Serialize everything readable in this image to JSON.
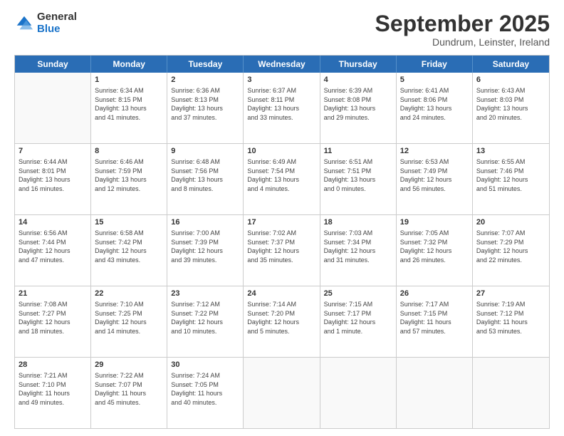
{
  "logo": {
    "general": "General",
    "blue": "Blue"
  },
  "title": "September 2025",
  "location": "Dundrum, Leinster, Ireland",
  "days": [
    "Sunday",
    "Monday",
    "Tuesday",
    "Wednesday",
    "Thursday",
    "Friday",
    "Saturday"
  ],
  "weeks": [
    [
      {
        "day": "",
        "info": ""
      },
      {
        "day": "1",
        "info": "Sunrise: 6:34 AM\nSunset: 8:15 PM\nDaylight: 13 hours\nand 41 minutes."
      },
      {
        "day": "2",
        "info": "Sunrise: 6:36 AM\nSunset: 8:13 PM\nDaylight: 13 hours\nand 37 minutes."
      },
      {
        "day": "3",
        "info": "Sunrise: 6:37 AM\nSunset: 8:11 PM\nDaylight: 13 hours\nand 33 minutes."
      },
      {
        "day": "4",
        "info": "Sunrise: 6:39 AM\nSunset: 8:08 PM\nDaylight: 13 hours\nand 29 minutes."
      },
      {
        "day": "5",
        "info": "Sunrise: 6:41 AM\nSunset: 8:06 PM\nDaylight: 13 hours\nand 24 minutes."
      },
      {
        "day": "6",
        "info": "Sunrise: 6:43 AM\nSunset: 8:03 PM\nDaylight: 13 hours\nand 20 minutes."
      }
    ],
    [
      {
        "day": "7",
        "info": "Sunrise: 6:44 AM\nSunset: 8:01 PM\nDaylight: 13 hours\nand 16 minutes."
      },
      {
        "day": "8",
        "info": "Sunrise: 6:46 AM\nSunset: 7:59 PM\nDaylight: 13 hours\nand 12 minutes."
      },
      {
        "day": "9",
        "info": "Sunrise: 6:48 AM\nSunset: 7:56 PM\nDaylight: 13 hours\nand 8 minutes."
      },
      {
        "day": "10",
        "info": "Sunrise: 6:49 AM\nSunset: 7:54 PM\nDaylight: 13 hours\nand 4 minutes."
      },
      {
        "day": "11",
        "info": "Sunrise: 6:51 AM\nSunset: 7:51 PM\nDaylight: 13 hours\nand 0 minutes."
      },
      {
        "day": "12",
        "info": "Sunrise: 6:53 AM\nSunset: 7:49 PM\nDaylight: 12 hours\nand 56 minutes."
      },
      {
        "day": "13",
        "info": "Sunrise: 6:55 AM\nSunset: 7:46 PM\nDaylight: 12 hours\nand 51 minutes."
      }
    ],
    [
      {
        "day": "14",
        "info": "Sunrise: 6:56 AM\nSunset: 7:44 PM\nDaylight: 12 hours\nand 47 minutes."
      },
      {
        "day": "15",
        "info": "Sunrise: 6:58 AM\nSunset: 7:42 PM\nDaylight: 12 hours\nand 43 minutes."
      },
      {
        "day": "16",
        "info": "Sunrise: 7:00 AM\nSunset: 7:39 PM\nDaylight: 12 hours\nand 39 minutes."
      },
      {
        "day": "17",
        "info": "Sunrise: 7:02 AM\nSunset: 7:37 PM\nDaylight: 12 hours\nand 35 minutes."
      },
      {
        "day": "18",
        "info": "Sunrise: 7:03 AM\nSunset: 7:34 PM\nDaylight: 12 hours\nand 31 minutes."
      },
      {
        "day": "19",
        "info": "Sunrise: 7:05 AM\nSunset: 7:32 PM\nDaylight: 12 hours\nand 26 minutes."
      },
      {
        "day": "20",
        "info": "Sunrise: 7:07 AM\nSunset: 7:29 PM\nDaylight: 12 hours\nand 22 minutes."
      }
    ],
    [
      {
        "day": "21",
        "info": "Sunrise: 7:08 AM\nSunset: 7:27 PM\nDaylight: 12 hours\nand 18 minutes."
      },
      {
        "day": "22",
        "info": "Sunrise: 7:10 AM\nSunset: 7:25 PM\nDaylight: 12 hours\nand 14 minutes."
      },
      {
        "day": "23",
        "info": "Sunrise: 7:12 AM\nSunset: 7:22 PM\nDaylight: 12 hours\nand 10 minutes."
      },
      {
        "day": "24",
        "info": "Sunrise: 7:14 AM\nSunset: 7:20 PM\nDaylight: 12 hours\nand 5 minutes."
      },
      {
        "day": "25",
        "info": "Sunrise: 7:15 AM\nSunset: 7:17 PM\nDaylight: 12 hours\nand 1 minute."
      },
      {
        "day": "26",
        "info": "Sunrise: 7:17 AM\nSunset: 7:15 PM\nDaylight: 11 hours\nand 57 minutes."
      },
      {
        "day": "27",
        "info": "Sunrise: 7:19 AM\nSunset: 7:12 PM\nDaylight: 11 hours\nand 53 minutes."
      }
    ],
    [
      {
        "day": "28",
        "info": "Sunrise: 7:21 AM\nSunset: 7:10 PM\nDaylight: 11 hours\nand 49 minutes."
      },
      {
        "day": "29",
        "info": "Sunrise: 7:22 AM\nSunset: 7:07 PM\nDaylight: 11 hours\nand 45 minutes."
      },
      {
        "day": "30",
        "info": "Sunrise: 7:24 AM\nSunset: 7:05 PM\nDaylight: 11 hours\nand 40 minutes."
      },
      {
        "day": "",
        "info": ""
      },
      {
        "day": "",
        "info": ""
      },
      {
        "day": "",
        "info": ""
      },
      {
        "day": "",
        "info": ""
      }
    ]
  ]
}
